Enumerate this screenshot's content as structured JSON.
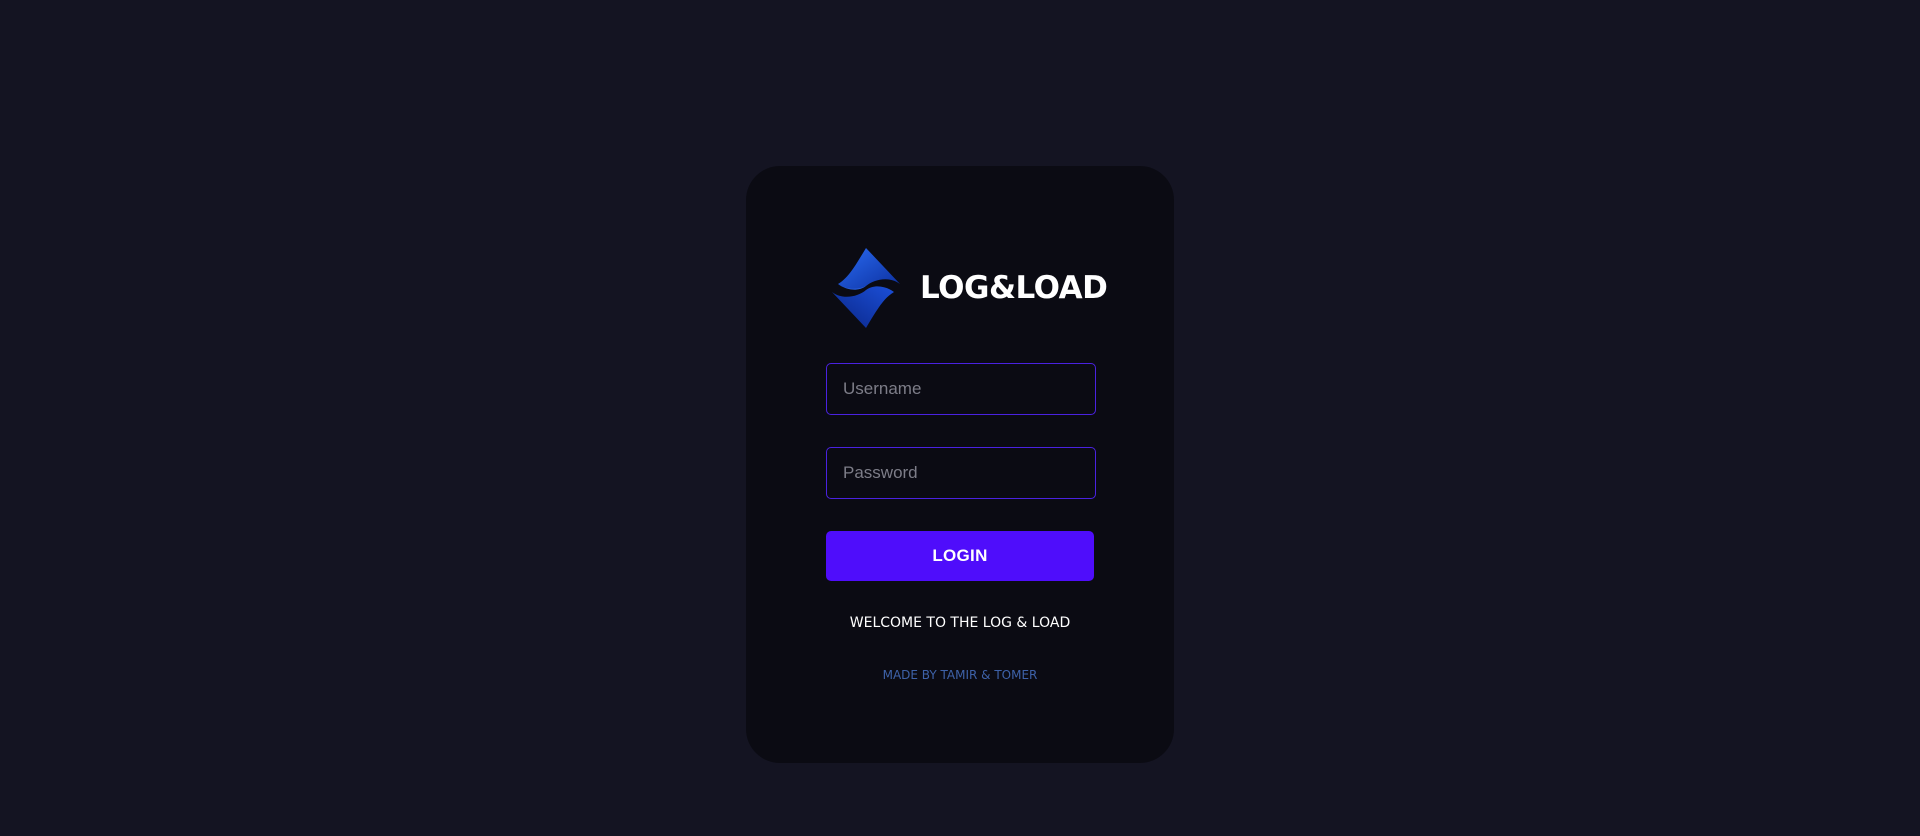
{
  "colors": {
    "page_background": "#141422",
    "card_background": "#0b0b13",
    "input_border": "#4a22e0",
    "accent_button": "#4f0dfb",
    "credits_text": "#3e62a8",
    "logo_blue": "#1a4fd6"
  },
  "brand": {
    "logo_icon": "brand-logo-icon",
    "name": "LOG&LOAD"
  },
  "login_form": {
    "username_placeholder": "Username",
    "password_placeholder": "Password",
    "login_label": "LOGIN"
  },
  "footer": {
    "welcome_text": "WELCOME TO THE LOG & LOAD",
    "credits_text": "MADE BY TAMIR & TOMER"
  }
}
